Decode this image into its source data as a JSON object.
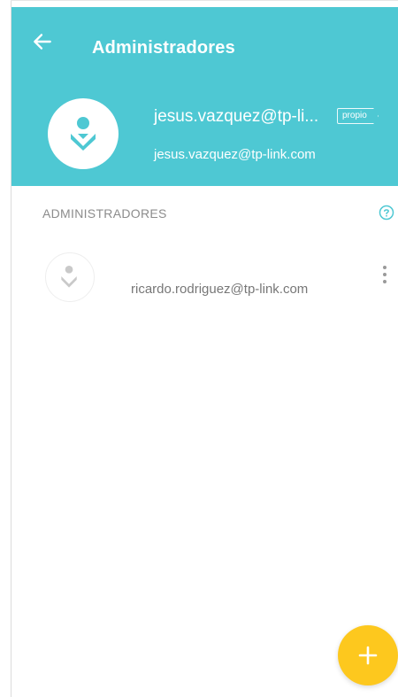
{
  "header": {
    "title": "Administradores",
    "owner_name": "jesus.vazquez@tp-li...",
    "owner_badge": "propio",
    "owner_email": "jesus.vazquez@tp-link.com",
    "background_color": "#4ec8d3"
  },
  "section": {
    "label": "ADMINISTRADORES",
    "help_icon": "help-circle-icon"
  },
  "admins": [
    {
      "email": "ricardo.rodriguez@tp-link.com"
    }
  ],
  "fab": {
    "icon": "plus-icon",
    "color": "#fdc81e"
  },
  "icons": {
    "back": "arrow-left-icon",
    "user": "user-icon",
    "menu": "more-vertical-icon"
  }
}
